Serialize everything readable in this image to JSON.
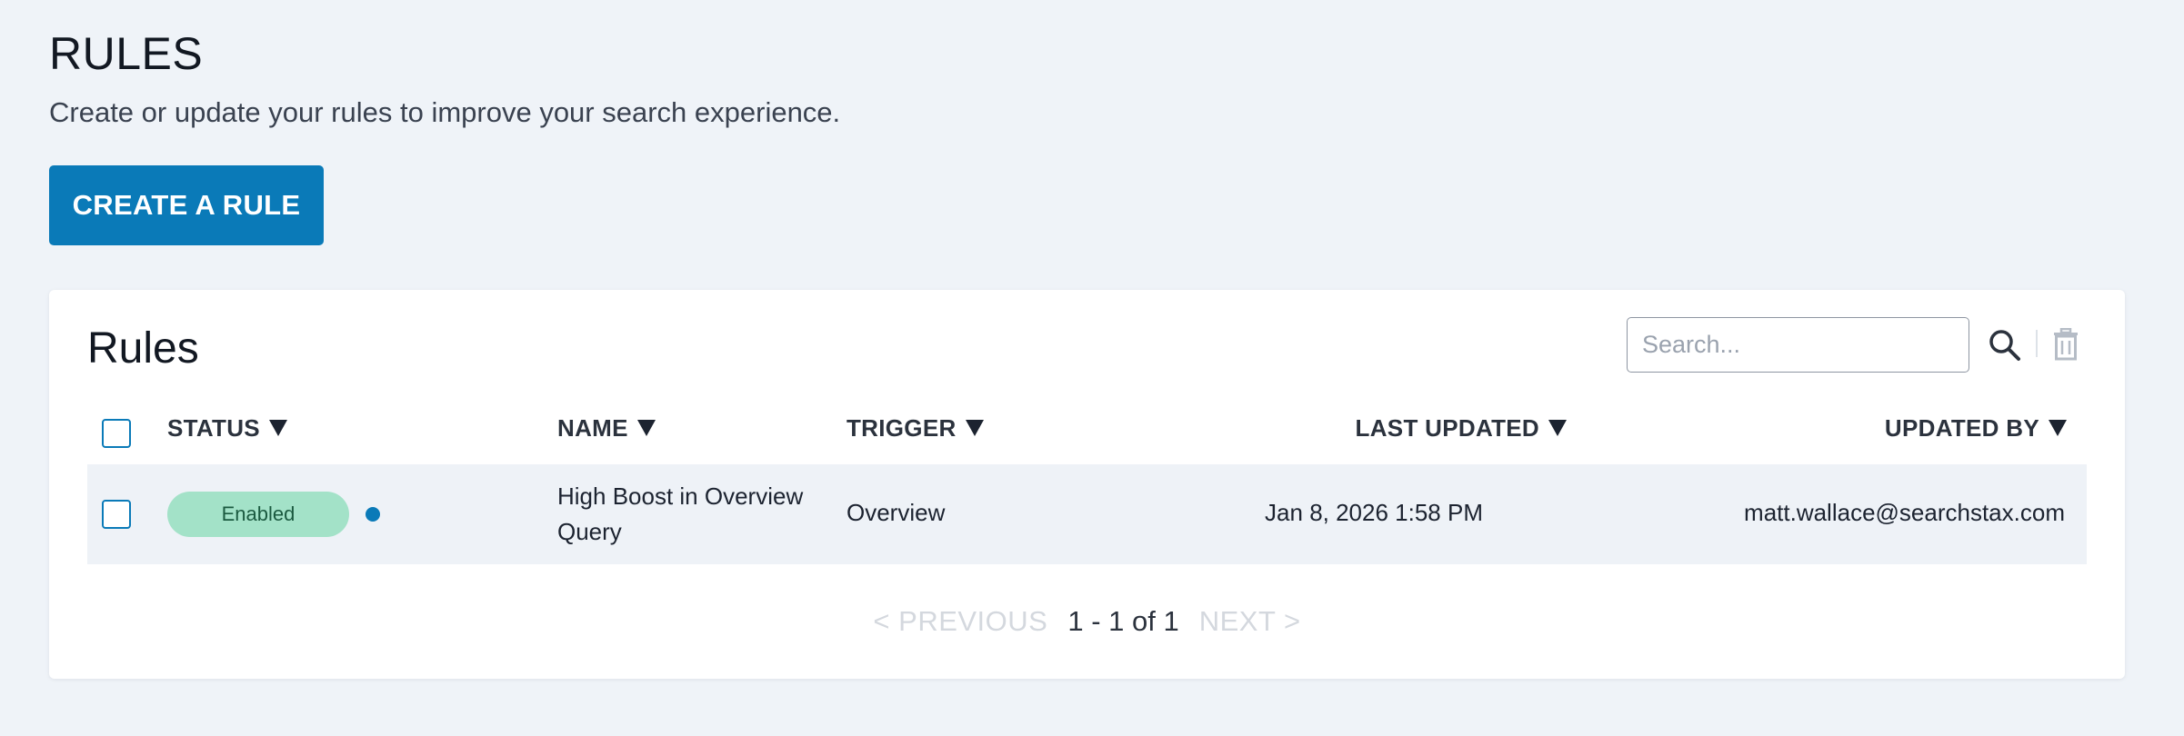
{
  "page": {
    "title": "RULES",
    "subtitle": "Create or update your rules to improve your search experience.",
    "create_button": "CREATE A RULE"
  },
  "card": {
    "title": "Rules",
    "search": {
      "placeholder": "Search...",
      "value": ""
    },
    "icons": {
      "search": "search-icon",
      "delete": "trash-icon"
    },
    "columns": [
      {
        "label": "STATUS"
      },
      {
        "label": "NAME"
      },
      {
        "label": "TRIGGER"
      },
      {
        "label": "LAST UPDATED"
      },
      {
        "label": "UPDATED BY"
      }
    ],
    "rows": [
      {
        "status": "Enabled",
        "name": "High Boost in Overview Query",
        "trigger": "Overview",
        "last_updated": "Jan 8, 2026 1:58 PM",
        "updated_by": "matt.wallace@searchstax.com"
      }
    ],
    "pagination": {
      "previous": "< PREVIOUS",
      "status": "1 - 1 of 1",
      "next": "NEXT >"
    }
  },
  "colors": {
    "primary": "#0a7ab8",
    "background": "#eff3f8",
    "enabled_badge": "#a3e2c8",
    "row_highlight": "#eef2f7"
  }
}
